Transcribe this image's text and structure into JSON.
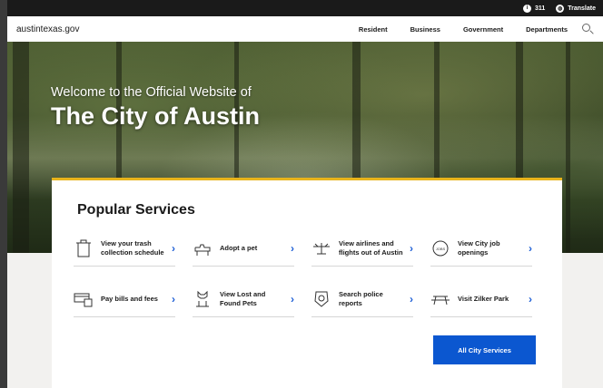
{
  "utility": {
    "item_311": "311",
    "translate": "Translate"
  },
  "header": {
    "logo": "austintexas.gov",
    "nav": [
      "Resident",
      "Business",
      "Government",
      "Departments"
    ],
    "search_icon": "search-icon"
  },
  "hero": {
    "subtitle": "Welcome to the Official Website of",
    "title": "The City of Austin"
  },
  "popular": {
    "heading": "Popular Services",
    "items": [
      {
        "label": "View your trash collection schedule",
        "icon": "trash-bin-icon"
      },
      {
        "label": "Adopt a pet",
        "icon": "dog-icon"
      },
      {
        "label": "View airlines and flights out of Austin",
        "icon": "airplane-icon"
      },
      {
        "label": "View City job openings",
        "icon": "jobs-icon"
      },
      {
        "label": "Pay bills and fees",
        "icon": "bill-icon"
      },
      {
        "label": "View Lost and Found Pets",
        "icon": "cat-icon"
      },
      {
        "label": "Search police reports",
        "icon": "police-badge-icon"
      },
      {
        "label": "Visit Zilker Park",
        "icon": "picnic-table-icon"
      }
    ],
    "all_button": "All City Services"
  },
  "colors": {
    "accent_blue": "#0b57d0",
    "gold_rule": "#e8b41c",
    "utility_bar": "#1a1a1a"
  }
}
